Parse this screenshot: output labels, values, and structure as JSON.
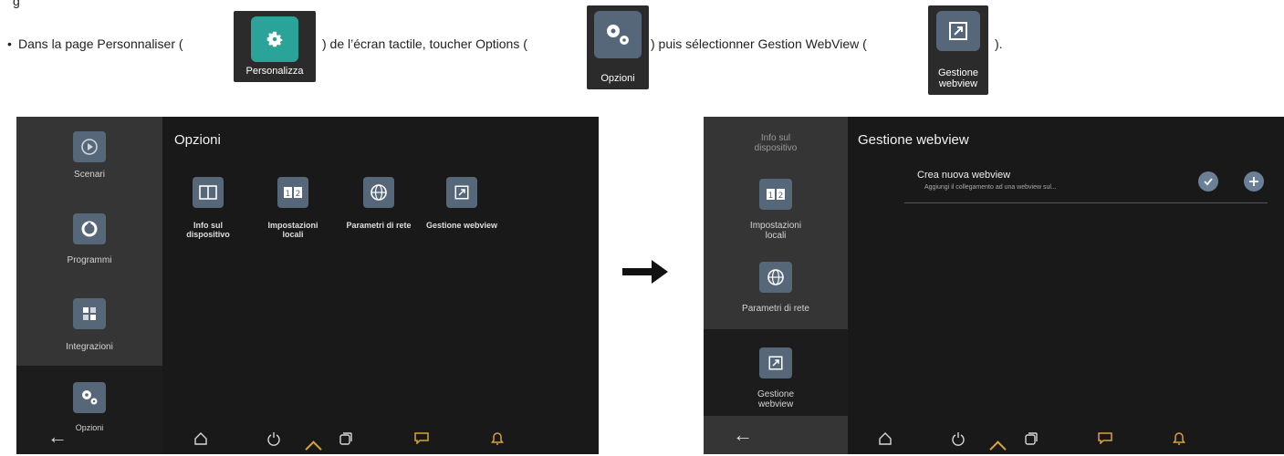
{
  "instruction": {
    "heading_fragment": "g",
    "bullet": "•",
    "segments": [
      "Dans la page Personnaliser (",
      ") de l’écran tactile, toucher Options (",
      ") puis sélectionner Gestion WebView (",
      ")."
    ],
    "icons": [
      {
        "name": "personalizza-icon",
        "label": "Personalizza",
        "tile_color": "#2aa398"
      },
      {
        "name": "opzioni-icon",
        "label": "Opzioni",
        "tile_color": "#56677a"
      },
      {
        "name": "gestione-webview-icon",
        "label": "Gestione webview",
        "tile_color": "#56677a"
      }
    ]
  },
  "screen_left": {
    "title": "Opzioni",
    "sidebar": [
      {
        "label": "Scenari",
        "icon": "scenari-icon"
      },
      {
        "label": "Programmi",
        "icon": "programmi-icon"
      },
      {
        "label": "Integrazioni",
        "icon": "integrazioni-icon"
      },
      {
        "label": "Opzioni",
        "icon": "opzioni-gear-icon",
        "active": true
      }
    ],
    "options": [
      {
        "label": "Info sul dispositivo",
        "icon": "book-icon"
      },
      {
        "label": "Impostazioni locali",
        "icon": "clock-icon"
      },
      {
        "label": "Parametri di rete",
        "icon": "network-icon"
      },
      {
        "label": "Gestione webview",
        "icon": "webview-icon"
      }
    ]
  },
  "screen_right": {
    "title": "Gestione webview",
    "sidebar": [
      {
        "label": "Info sul dispositivo",
        "icon": "info-icon"
      },
      {
        "label": "Impostazioni locali",
        "icon": "clock-icon"
      },
      {
        "label": "Parametri di rete",
        "icon": "network-icon"
      },
      {
        "label": "Gestione webview",
        "icon": "webview-icon",
        "active": true
      }
    ],
    "list_item": {
      "title": "Crea nuova webview",
      "subtitle": "Aggiungi il collegamento ad una webview sul..."
    }
  },
  "colors": {
    "screen_bg": "#191919",
    "sidebar_bg": "#353535",
    "tile": "#56677a",
    "accent_yellow": "#d9a23a",
    "button_blue": "#6b7f97"
  }
}
